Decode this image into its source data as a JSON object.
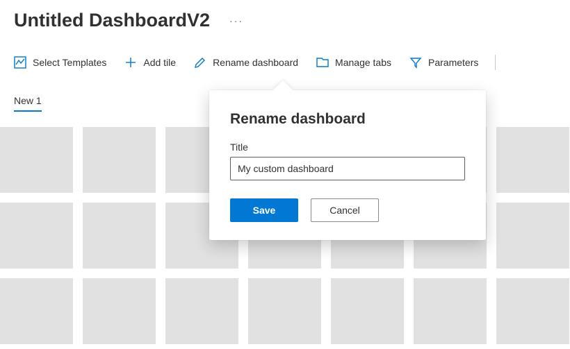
{
  "header": {
    "title": "Untitled DashboardV2",
    "more_glyph": "···"
  },
  "toolbar": {
    "select_templates": "Select Templates",
    "add_tile": "Add tile",
    "rename_dashboard": "Rename dashboard",
    "manage_tabs": "Manage tabs",
    "parameters": "Parameters"
  },
  "tabs": {
    "active": "New 1"
  },
  "dialog": {
    "title": "Rename dashboard",
    "field_label": "Title",
    "field_value": "My custom dashboard",
    "save_label": "Save",
    "cancel_label": "Cancel"
  },
  "colors": {
    "accent": "#0078d4",
    "text": "#323130",
    "tile": "#e1e1e1"
  },
  "grid": {
    "rows": 3,
    "cols": 7
  }
}
